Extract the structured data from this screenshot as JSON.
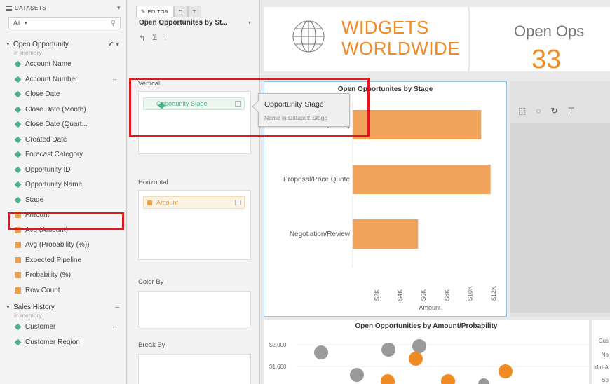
{
  "sidebar": {
    "header": "DATASETS",
    "filter_value": "All",
    "datasets": [
      {
        "name": "Open Opportunity",
        "status": "in memory",
        "fields": [
          {
            "label": "Account Name",
            "kind": "dimension"
          },
          {
            "label": "Account Number",
            "kind": "dimension"
          },
          {
            "label": "Close Date",
            "kind": "dimension"
          },
          {
            "label": "Close Date (Month)",
            "kind": "date"
          },
          {
            "label": "Close Date (Quart...",
            "kind": "date"
          },
          {
            "label": "Created Date",
            "kind": "dimension"
          },
          {
            "label": "Forecast Category",
            "kind": "dimension"
          },
          {
            "label": "Opportunity ID",
            "kind": "dimension"
          },
          {
            "label": "Opportunity Name",
            "kind": "dimension"
          },
          {
            "label": "Stage",
            "kind": "dimension"
          },
          {
            "label": "Amount",
            "kind": "measure"
          },
          {
            "label": "Avg (Amount)",
            "kind": "calc"
          },
          {
            "label": "Avg (Probability (%))",
            "kind": "calc"
          },
          {
            "label": "Expected Pipeline",
            "kind": "calc"
          },
          {
            "label": "Probability (%)",
            "kind": "measure"
          },
          {
            "label": "Row Count",
            "kind": "calc"
          }
        ]
      },
      {
        "name": "Sales History",
        "status": "in memory",
        "fields": [
          {
            "label": "Customer",
            "kind": "dimension"
          },
          {
            "label": "Customer Region",
            "kind": "dimension"
          }
        ]
      }
    ]
  },
  "editor": {
    "tab_editor": "EDITOR",
    "tab_2": "O",
    "tab_3": "T",
    "title": "Open Opportunites by St...",
    "sections": {
      "vertical": "Vertical",
      "horizontal": "Horizontal",
      "color_by": "Color By",
      "break_by": "Break By"
    },
    "vertical_pill": "Opportunity Stage",
    "horizontal_pill": "Amount"
  },
  "tooltip": {
    "title": "Opportunity Stage",
    "subtitle": "Name in Dataset: Stage"
  },
  "dashboard": {
    "brand_line1": "WIDGETS",
    "brand_line2": "WORLDWIDE",
    "kpi_label": "Open Ops",
    "kpi_value": "33",
    "scatter_title": "Open Opportunities by Amount/Probability",
    "scatter_y_ticks": [
      "$2,000",
      "$1,600"
    ],
    "side_labels": [
      "Cus",
      "No",
      "Mid-A",
      "So"
    ]
  },
  "chart_data": {
    "type": "bar",
    "title": "Open Opportunites by Stage",
    "orientation": "horizontal",
    "categories": [
      "Prospecting",
      "Proposal/Price Quote",
      "Negotiation/Review"
    ],
    "values": [
      11000,
      11800,
      5600
    ],
    "xlabel": "Amount",
    "x_ticks": [
      "$2K",
      "$4K",
      "$6K",
      "$8K",
      "$10K",
      "$12K"
    ],
    "xlim": [
      0,
      12000
    ],
    "bar_color": "#f0a35a"
  },
  "colors": {
    "accent_orange": "#f08a24",
    "dimension_green": "#4fae8b",
    "highlight_red": "#e0171c",
    "selected_border": "#8ec4e9"
  }
}
